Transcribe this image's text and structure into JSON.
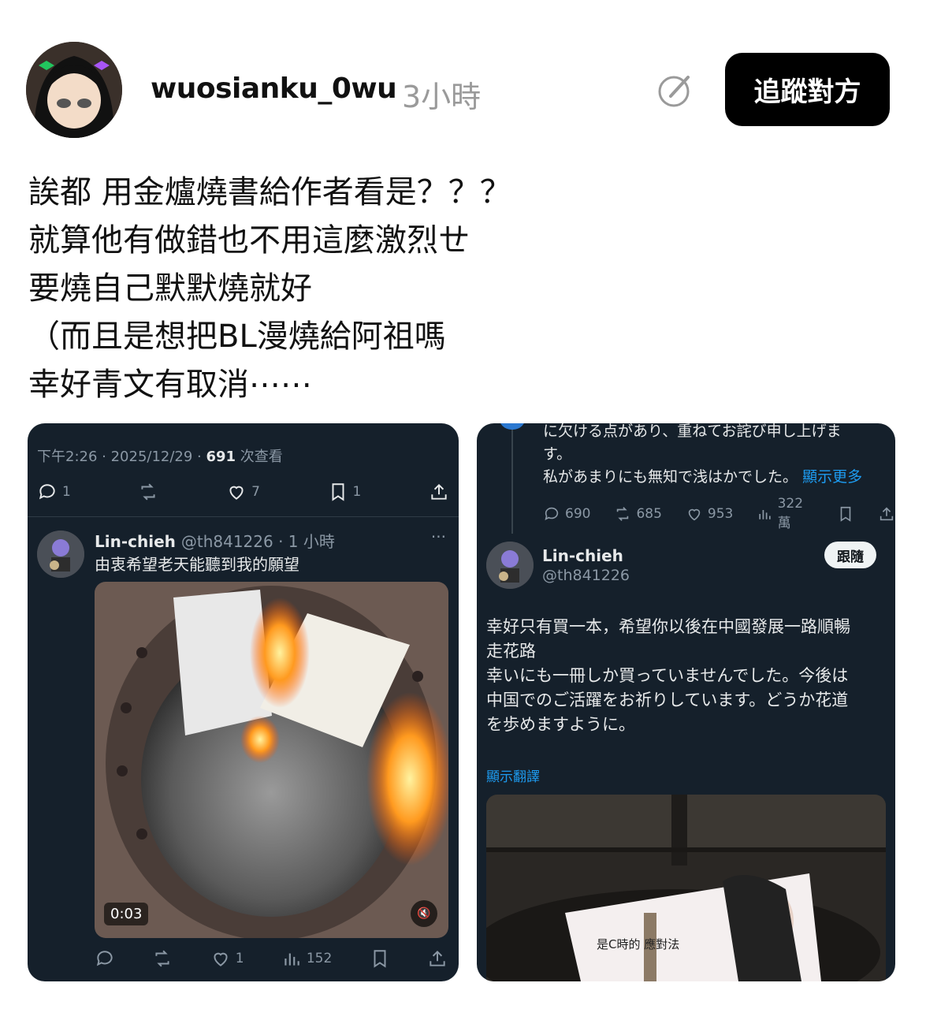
{
  "header": {
    "username": "wuosianku_0wu",
    "time": "3小時",
    "follow_label": "追蹤對方"
  },
  "post": {
    "lines": [
      "誒都 用金爐燒書給作者看是？？？",
      "就算他有做錯也不用這麼激烈ㄝ",
      "要燒自己默默燒就好",
      "（而且是想把BL漫燒給阿祖嗎",
      "幸好青文有取消⋯⋯"
    ]
  },
  "left_card": {
    "meta_time": "下午2:26 · 2025/12/29 · ",
    "meta_views": "691",
    "meta_views_label": " 次查看",
    "actions": {
      "reply": "1",
      "retweet": "",
      "like": "7",
      "bookmark": "1"
    },
    "quoted": {
      "name": "Lin-chieh",
      "handle": "@th841226 · 1 小時",
      "more": "···",
      "text": "由衷希望老天能聽到我的願望",
      "video_time": "0:03"
    },
    "bottom_actions": {
      "reply": "",
      "retweet": "",
      "like": "1",
      "views": "152"
    }
  },
  "right_card": {
    "prev_text": [
      "に欠ける点があり、重ねてお詫び申し上げま",
      "す。",
      "私があまりにも無知で浅はかでした。"
    ],
    "show_more": "顯示更多",
    "stats": {
      "reply": "690",
      "retweet": "685",
      "like": "953",
      "views": "322萬"
    },
    "name": "Lin-chieh",
    "handle": "@th841226",
    "follow_label": "跟隨",
    "reply_lines": [
      "幸好只有買一本，希望你以後在中國發展一路順暢",
      "走花路",
      "幸いにも一冊しか買っていませんでした。今後は",
      "中国でのご活躍をお祈りしています。どうか花道",
      "を歩めますように。"
    ],
    "translate_label": "顯示翻譯",
    "book_text": "是C時的 應對法"
  },
  "colors": {
    "card_bg": "#15202b",
    "accent_blue": "#1d9bf0",
    "follow_bg": "#000000"
  }
}
